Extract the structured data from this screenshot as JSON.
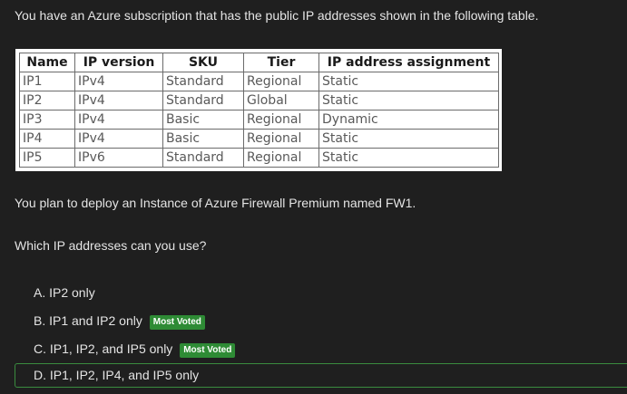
{
  "question": {
    "intro": "You have an Azure subscription that has the public IP addresses shown in the following table.",
    "plan": "You plan to deploy an Instance of Azure Firewall Premium named FW1.",
    "prompt": "Which IP addresses can you use?"
  },
  "table": {
    "headers": [
      "Name",
      "IP version",
      "SKU",
      "Tier",
      "IP address assignment"
    ],
    "rows": [
      [
        "IP1",
        "IPv4",
        "Standard",
        "Regional",
        "Static"
      ],
      [
        "IP2",
        "IPv4",
        "Standard",
        "Global",
        "Static"
      ],
      [
        "IP3",
        "IPv4",
        "Basic",
        "Regional",
        "Dynamic"
      ],
      [
        "IP4",
        "IPv4",
        "Basic",
        "Regional",
        "Static"
      ],
      [
        "IP5",
        "IPv6",
        "Standard",
        "Regional",
        "Static"
      ]
    ]
  },
  "options": [
    {
      "label": "A. IP2 only",
      "badge": ""
    },
    {
      "label": "B. IP1 and IP2 only",
      "badge": "Most Voted"
    },
    {
      "label": "C. IP1, IP2, and IP5 only",
      "badge": "Most Voted"
    },
    {
      "label": "D. IP1, IP2, IP4, and IP5 only",
      "badge": ""
    }
  ],
  "selected_option_index": 3,
  "colors": {
    "background": "#1f1f1f",
    "badge": "#2e8b35",
    "selected_border": "#3a8c3f"
  }
}
